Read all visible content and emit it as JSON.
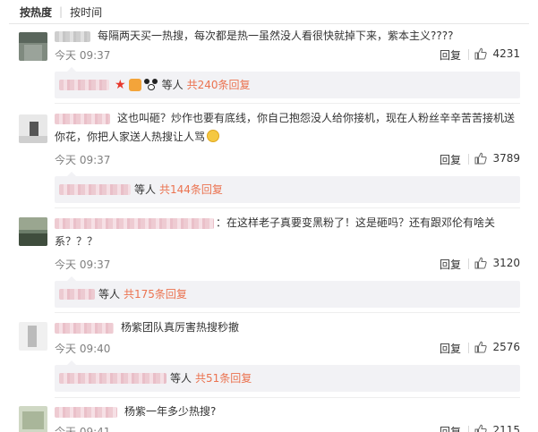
{
  "sort": {
    "hot_label": "按热度",
    "time_label": "按时间"
  },
  "comments": [
    {
      "text": "每隔两天买一热搜，每次都是热一虽然没人看很快就掉下来，紫本主义????",
      "time": "今天 09:37",
      "reply_label": "回复",
      "likes": "4231",
      "sub_who": "等人",
      "sub_count": "共240条回复"
    },
    {
      "text": "这也叫砸？炒作也要有底线，你自己抱怨没人给你接机，现在人粉丝辛辛苦苦接机送你花，你把人家送人热搜让人骂",
      "time": "今天 09:37",
      "reply_label": "回复",
      "likes": "3789",
      "sub_who": "等人",
      "sub_count": "共144条回复"
    },
    {
      "text": "：在这样老子真要变黑粉了！这是砸吗？还有跟邓伦有啥关系？？？",
      "time": "今天 09:37",
      "reply_label": "回复",
      "likes": "3120",
      "sub_who": "等人",
      "sub_count": "共175条回复"
    },
    {
      "text": "杨紫团队真厉害热搜秒撤",
      "time": "今天 09:40",
      "reply_label": "回复",
      "likes": "2576",
      "sub_who": "等人",
      "sub_count": "共51条回复"
    },
    {
      "text": "杨紫一年多少热搜?",
      "time": "今天 09:41",
      "reply_label": "回复",
      "likes": "2115"
    }
  ],
  "colors": {
    "accent": "#eb7350",
    "subbox_bg": "#f2f2f5",
    "muted": "#808080"
  },
  "icons": {
    "like": "thumbs-up-icon"
  }
}
